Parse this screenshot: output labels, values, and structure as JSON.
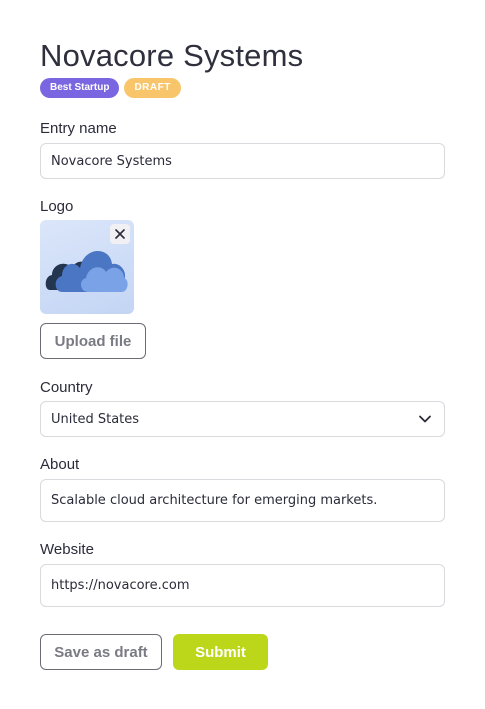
{
  "header": {
    "title": "Novacore Systems",
    "badges": [
      "Best Startup",
      "DRAFT"
    ]
  },
  "form": {
    "entry_name": {
      "label": "Entry name",
      "value": "Novacore Systems"
    },
    "logo": {
      "label": "Logo",
      "remove_icon": "close-icon",
      "upload_label": "Upload file"
    },
    "country": {
      "label": "Country",
      "value": "United States",
      "icon": "chevron-down-icon"
    },
    "about": {
      "label": "About",
      "value": "Scalable cloud architecture for emerging markets."
    },
    "website": {
      "label": "Website",
      "value": "https://novacore.com"
    }
  },
  "actions": {
    "save_draft_label": "Save as draft",
    "submit_label": "Submit"
  },
  "colors": {
    "badge_startup": "#7a66e0",
    "badge_draft": "#f9c56b",
    "submit": "#bcd61a",
    "text": "#2b2b3a"
  }
}
